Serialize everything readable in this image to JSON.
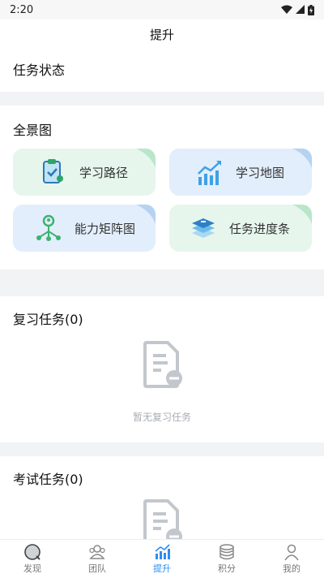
{
  "status_bar": {
    "time": "2:20"
  },
  "header": {
    "title": "提升"
  },
  "task_status": {
    "title": "任务状态"
  },
  "overview": {
    "title": "全景图",
    "tiles": [
      {
        "label": "学习路径",
        "icon": "clipboard-check-icon",
        "color": "#e6f6ec"
      },
      {
        "label": "学习地图",
        "icon": "trending-bars-icon",
        "color": "#e2eefb"
      },
      {
        "label": "能力矩阵图",
        "icon": "network-people-icon",
        "color": "#e2eefb"
      },
      {
        "label": "任务进度条",
        "icon": "layers-icon",
        "color": "#e6f6ec"
      }
    ]
  },
  "review": {
    "title": "复习任务(0)",
    "empty_text": "暂无复习任务"
  },
  "exam": {
    "title": "考试任务(0)"
  },
  "tabs": [
    {
      "label": "发现",
      "icon": "discover-icon"
    },
    {
      "label": "团队",
      "icon": "team-icon"
    },
    {
      "label": "提升",
      "icon": "improve-icon",
      "active": true
    },
    {
      "label": "积分",
      "icon": "points-icon"
    },
    {
      "label": "我的",
      "icon": "profile-icon"
    }
  ],
  "colors": {
    "accent": "#2f8cf0",
    "green_tile": "#e6f6ec",
    "blue_tile": "#e2eefb"
  }
}
